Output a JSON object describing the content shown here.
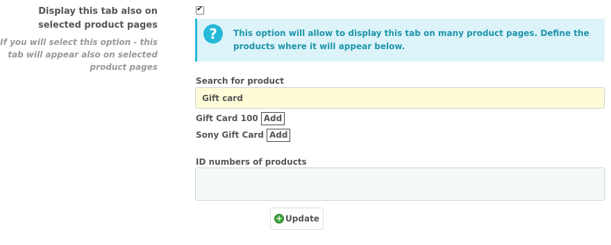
{
  "option": {
    "label": "Display this tab also on selected product pages",
    "help": "If you will select this option - this tab will appear also on selected product pages",
    "checked": true
  },
  "info": {
    "icon": "question-icon",
    "icon_glyph": "?",
    "text": "This option will allow to display this tab on many product pages. Define the products where it will appear below."
  },
  "search": {
    "label": "Search for product",
    "value": "Gift card",
    "results": [
      {
        "name": "Gift Card 100",
        "add_label": "Add"
      },
      {
        "name": "Sony Gift Card",
        "add_label": "Add"
      }
    ]
  },
  "ids": {
    "label": "ID numbers of products",
    "value": ""
  },
  "update": {
    "label": "Update",
    "icon": "plus-circle-icon",
    "icon_glyph": "+"
  },
  "colors": {
    "info_bg": "#dcf4f9",
    "info_accent": "#25b9d7",
    "info_text": "#1e94ab",
    "search_bg": "#fffbd8"
  }
}
